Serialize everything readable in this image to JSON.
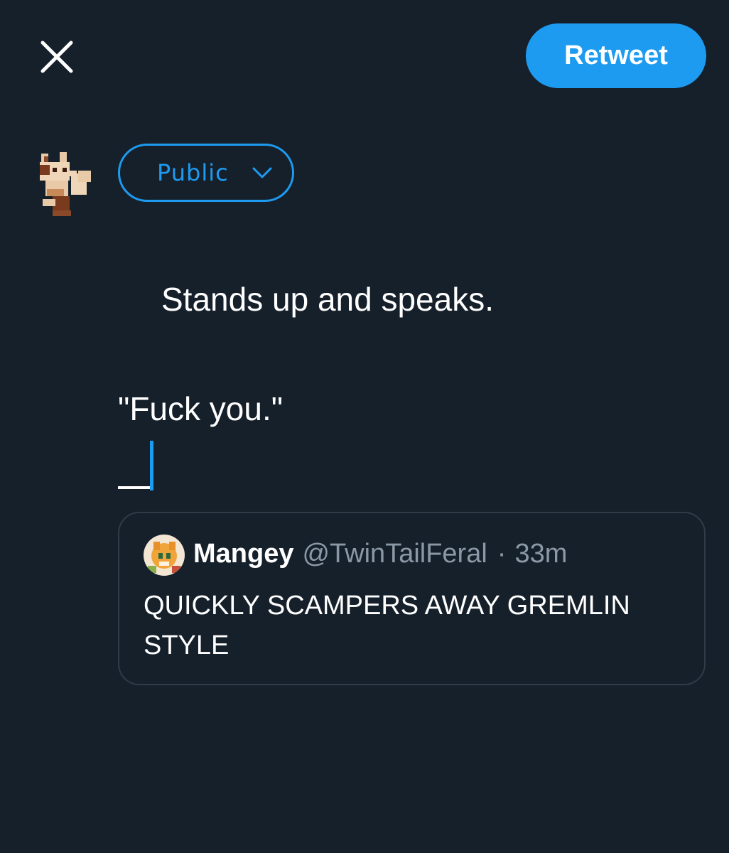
{
  "header": {
    "close_icon": "close-icon",
    "retweet_label": "Retweet"
  },
  "composer": {
    "avatar_icon": "fox-avatar",
    "audience": {
      "label": "Public",
      "icon": "chevron-down-icon"
    },
    "text_line1": "Stands up and speaks.",
    "text_line2": "\"Fuck you.\""
  },
  "quoted_tweet": {
    "avatar_icon": "fox-avatar",
    "name": "Mangey",
    "handle": "@TwinTailFeral",
    "separator": "·",
    "time": "33m",
    "text": "QUICKLY SCAMPERS AWAY GREMLIN STYLE"
  },
  "colors": {
    "background": "#16202b",
    "accent": "#1d9bf0",
    "muted_text": "#8b98a5",
    "card_border": "#2f3b47"
  }
}
